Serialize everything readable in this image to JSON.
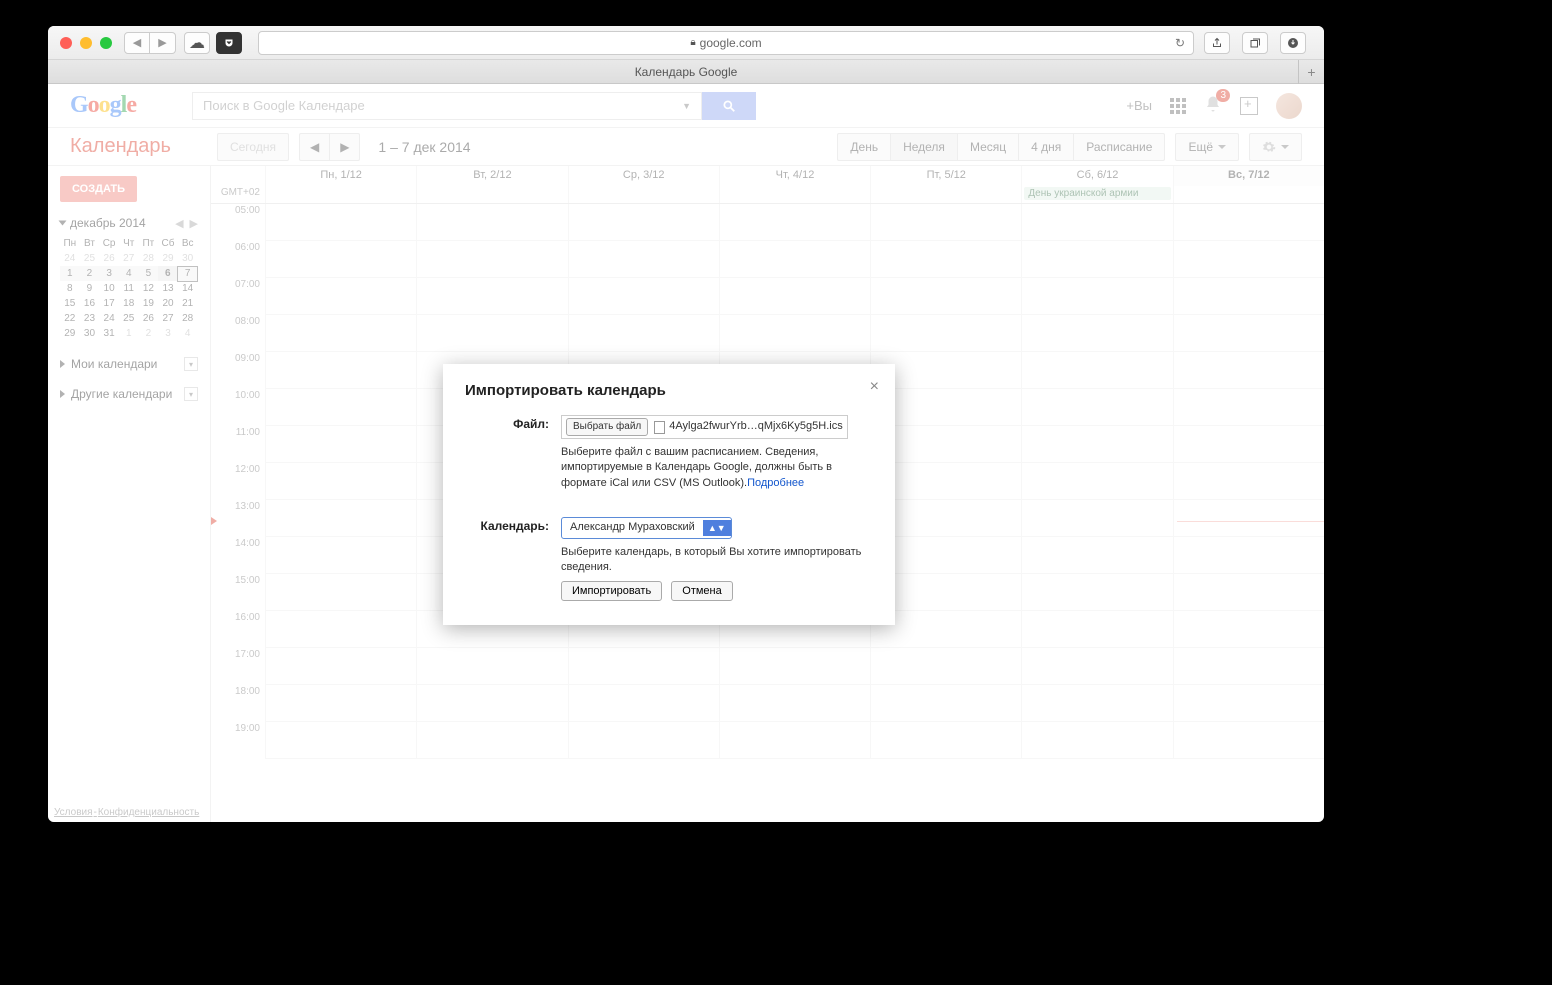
{
  "browser": {
    "url": "google.com",
    "tab_title": "Календарь Google"
  },
  "header": {
    "logo": "Google",
    "search_placeholder": "Поиск в Google Календаре",
    "plus_you": "+Вы",
    "notification_count": "3"
  },
  "toolbar": {
    "app_name": "Календарь",
    "today": "Сегодня",
    "date_range": "1 – 7 дек 2014",
    "views": {
      "day": "День",
      "week": "Неделя",
      "month": "Месяц",
      "four_days": "4 дня",
      "schedule": "Расписание"
    },
    "more": "Ещё"
  },
  "sidebar": {
    "create": "СОЗДАТЬ",
    "mini_month": "декабрь 2014",
    "dow": [
      "Пн",
      "Вт",
      "Ср",
      "Чт",
      "Пт",
      "Сб",
      "Вс"
    ],
    "weeks": [
      [
        {
          "d": "24",
          "o": 1
        },
        {
          "d": "25",
          "o": 1
        },
        {
          "d": "26",
          "o": 1
        },
        {
          "d": "27",
          "o": 1
        },
        {
          "d": "28",
          "o": 1
        },
        {
          "d": "29",
          "o": 1
        },
        {
          "d": "30",
          "o": 1
        }
      ],
      [
        {
          "d": "1"
        },
        {
          "d": "2"
        },
        {
          "d": "3"
        },
        {
          "d": "4"
        },
        {
          "d": "5"
        },
        {
          "d": "6"
        },
        {
          "d": "7",
          "t": 1
        }
      ],
      [
        {
          "d": "8"
        },
        {
          "d": "9"
        },
        {
          "d": "10"
        },
        {
          "d": "11"
        },
        {
          "d": "12"
        },
        {
          "d": "13"
        },
        {
          "d": "14"
        }
      ],
      [
        {
          "d": "15"
        },
        {
          "d": "16"
        },
        {
          "d": "17"
        },
        {
          "d": "18"
        },
        {
          "d": "19"
        },
        {
          "d": "20"
        },
        {
          "d": "21"
        }
      ],
      [
        {
          "d": "22"
        },
        {
          "d": "23"
        },
        {
          "d": "24"
        },
        {
          "d": "25"
        },
        {
          "d": "26"
        },
        {
          "d": "27"
        },
        {
          "d": "28"
        }
      ],
      [
        {
          "d": "29"
        },
        {
          "d": "30"
        },
        {
          "d": "31"
        },
        {
          "d": "1",
          "o": 1
        },
        {
          "d": "2",
          "o": 1
        },
        {
          "d": "3",
          "o": 1
        },
        {
          "d": "4",
          "o": 1
        }
      ]
    ],
    "my_calendars": "Мои календари",
    "other_calendars": "Другие календари"
  },
  "grid": {
    "tz": "GMT+02",
    "days": [
      "Пн, 1/12",
      "Вт, 2/12",
      "Ср, 3/12",
      "Чт, 4/12",
      "Пт, 5/12",
      "Сб, 6/12",
      "Вс, 7/12"
    ],
    "hours": [
      "05:00",
      "06:00",
      "07:00",
      "08:00",
      "09:00",
      "10:00",
      "11:00",
      "12:00",
      "13:00",
      "14:00",
      "15:00",
      "16:00",
      "17:00",
      "18:00",
      "19:00"
    ],
    "allday_event": "День украинской армии"
  },
  "modal": {
    "title": "Импортировать календарь",
    "file_label": "Файл:",
    "choose_file": "Выбрать файл",
    "filename": "4Aylga2fwurYrb…qMjx6Ky5g5H.ics",
    "file_help": "Выберите файл с вашим расписанием. Сведения, импортируемые в Календарь Google, должны быть в формате iCal или CSV (MS Outlook).",
    "learn_more": "Подробнее",
    "calendar_label": "Календарь:",
    "calendar_value": "Александр Мураховский",
    "calendar_help": "Выберите календарь, в который Вы хотите импортировать сведения.",
    "import_btn": "Импортировать",
    "cancel_btn": "Отмена"
  },
  "footer": {
    "terms": "Условия",
    "privacy": "Конфиденциальность"
  }
}
